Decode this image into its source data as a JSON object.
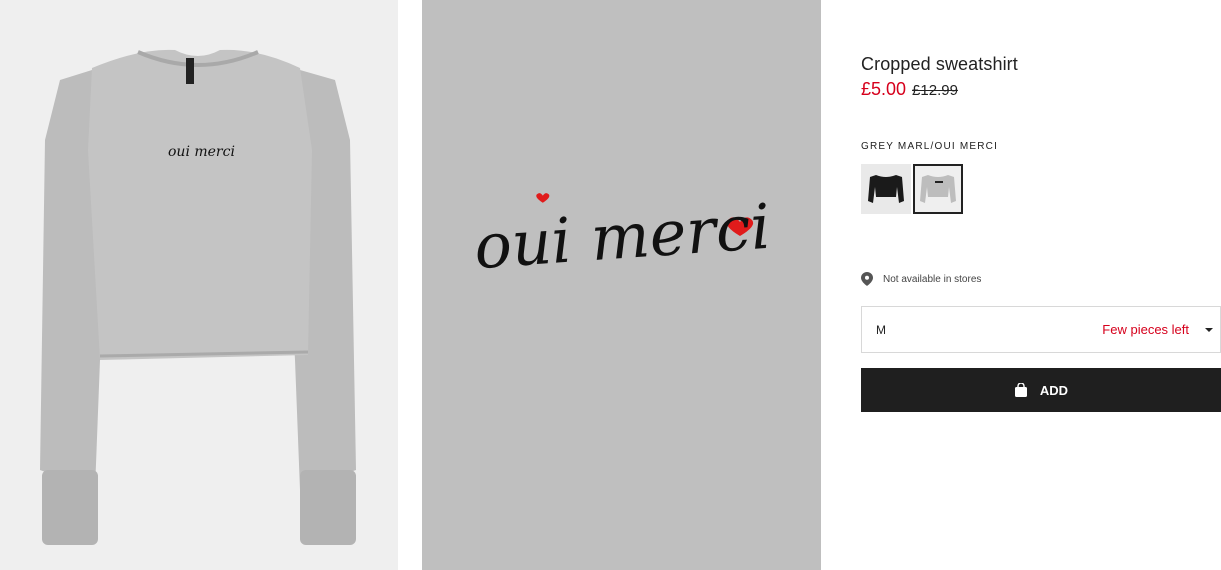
{
  "product": {
    "title": "Cropped sweatshirt",
    "price_sale": "£5.00",
    "price_original": "£12.99",
    "color_name": "GREY MARL/OUI MERCI",
    "swatches": [
      {
        "name": "black",
        "selected": false
      },
      {
        "name": "grey marl/oui merci",
        "selected": true
      }
    ],
    "store_availability": "Not available in stores",
    "size": {
      "value": "M",
      "stock_status": "Few pieces left"
    },
    "add_button_label": "ADD"
  },
  "images": {
    "main_print_text": "oui merci",
    "detail_print_text": "oui merci"
  },
  "colors": {
    "sale_red": "#d6001c",
    "button_black": "#1f1f1f",
    "sweatshirt_grey": "#b9b9b9"
  }
}
